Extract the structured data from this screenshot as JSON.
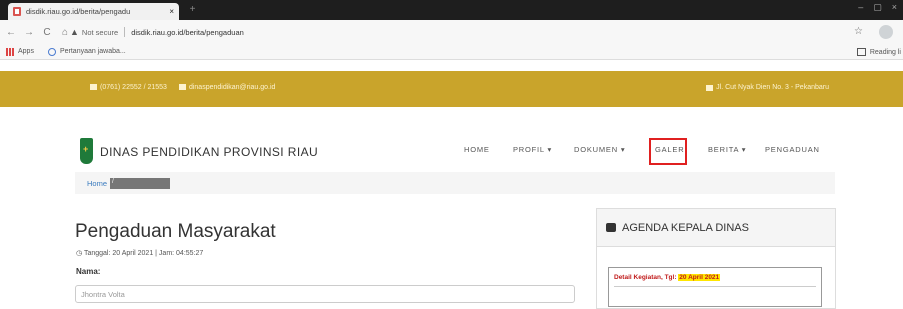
{
  "browser": {
    "tab_title": "disdik.riau.go.id/berita/pengadu",
    "tab_close": "×",
    "new_tab": "+",
    "window_controls": [
      "–",
      "▢",
      "×"
    ],
    "back": "←",
    "forward": "→",
    "reload": "C",
    "home": "⌂",
    "security_label": "Not secure",
    "url": "disdik.riau.go.id/berita/pengaduan",
    "bookmark_star": "☆",
    "bookmarks": [
      "Apps",
      "Pertanyaan jawaba..."
    ],
    "reading_list": "Reading li"
  },
  "infobar": {
    "phone": "(0761) 22552 / 21553",
    "email": "dinaspendidikan@riau.go.id",
    "address": "Jl. Cut Nyak Dien No. 3 - Pekanbaru",
    "color": "#c9a42b"
  },
  "site": {
    "title": "DINAS PENDIDIKAN PROVINSI RIAU",
    "nav": [
      "HOME",
      "PROFIL ▾",
      "DOKUMEN ▾",
      "GALERI",
      "BERITA ▾",
      "PENGADUAN"
    ],
    "highlighted_nav": "GALERI",
    "highlight_color": "#e02020"
  },
  "breadcrumb": {
    "home": "Home",
    "separator": "/"
  },
  "content": {
    "title": "Pengaduan Masyarakat",
    "meta": "Tanggal: 20 April 2021 | Jam: 04:55:27",
    "name_label": "Nama:",
    "name_value": "Jhontra Volta"
  },
  "agenda": {
    "title": "AGENDA KEPALA DINAS",
    "detail_label": "Detail Kegiatan, Tgl:",
    "detail_date": "20 April 2021"
  }
}
